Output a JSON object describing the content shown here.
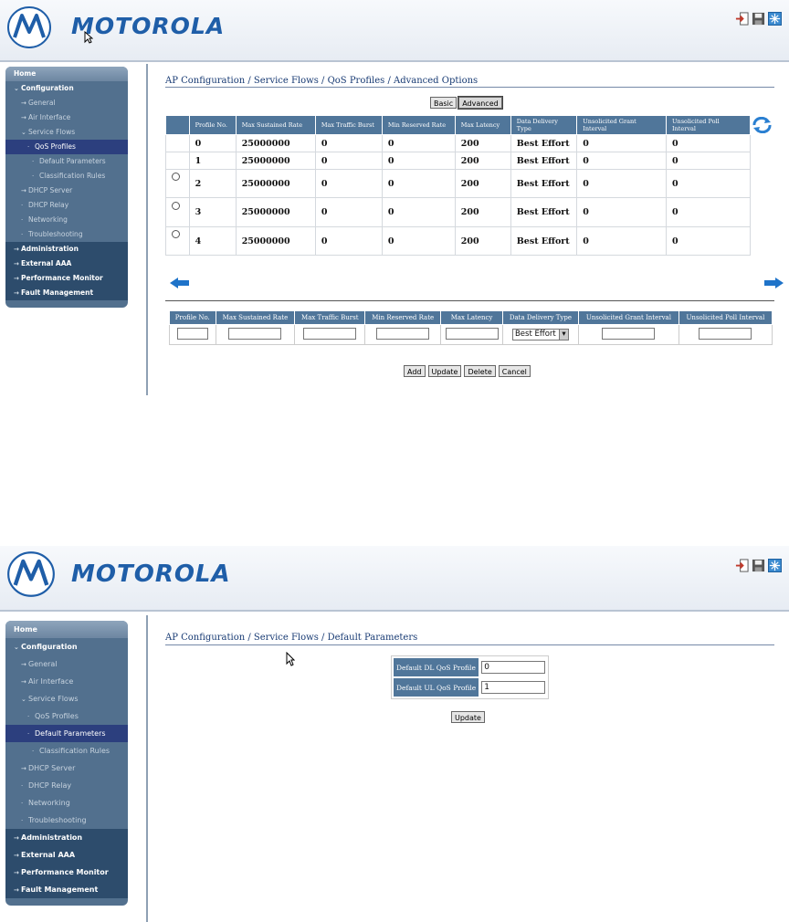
{
  "brand": {
    "name": "MOTOROLA",
    "accent": "#1f5ea8"
  },
  "header_icons": [
    "logout-icon",
    "save-icon",
    "snowflake-icon"
  ],
  "sidebar1": [
    {
      "label": "Home",
      "kind": "home"
    },
    {
      "label": "Configuration",
      "kind": "bold",
      "icon": "chevron-down-icon"
    },
    {
      "label": "General",
      "kind": "l1",
      "icon": "arrow-right-icon"
    },
    {
      "label": "Air Interface",
      "kind": "l1",
      "icon": "arrow-right-icon"
    },
    {
      "label": "Service Flows",
      "kind": "l1",
      "icon": "chevron-down-icon"
    },
    {
      "label": "QoS Profiles",
      "kind": "l2",
      "active": true
    },
    {
      "label": "Default Parameters",
      "kind": "l3"
    },
    {
      "label": "Classification Rules",
      "kind": "l3"
    },
    {
      "label": "DHCP Server",
      "kind": "l1",
      "icon": "arrow-right-icon"
    },
    {
      "label": "DHCP Relay",
      "kind": "l1"
    },
    {
      "label": "Networking",
      "kind": "l1"
    },
    {
      "label": "Troubleshooting",
      "kind": "l1"
    },
    {
      "label": "Administration",
      "kind": "bold-sec",
      "icon": "arrow-right-icon"
    },
    {
      "label": "External AAA",
      "kind": "bold-sec",
      "icon": "arrow-right-icon"
    },
    {
      "label": "Performance Monitor",
      "kind": "bold-sec",
      "icon": "arrow-right-icon"
    },
    {
      "label": "Fault Management",
      "kind": "bold-sec",
      "icon": "arrow-right-icon"
    }
  ],
  "sidebar2": [
    {
      "label": "Home",
      "kind": "home"
    },
    {
      "label": "Configuration",
      "kind": "bold",
      "icon": "chevron-down-icon"
    },
    {
      "label": "General",
      "kind": "l1",
      "icon": "arrow-right-icon"
    },
    {
      "label": "Air Interface",
      "kind": "l1",
      "icon": "arrow-right-icon"
    },
    {
      "label": "Service Flows",
      "kind": "l1",
      "icon": "chevron-down-icon"
    },
    {
      "label": "QoS Profiles",
      "kind": "l2"
    },
    {
      "label": "Default Parameters",
      "kind": "l2",
      "active": true
    },
    {
      "label": "Classification Rules",
      "kind": "l3"
    },
    {
      "label": "DHCP Server",
      "kind": "l1",
      "icon": "arrow-right-icon"
    },
    {
      "label": "DHCP Relay",
      "kind": "l1"
    },
    {
      "label": "Networking",
      "kind": "l1"
    },
    {
      "label": "Troubleshooting",
      "kind": "l1"
    },
    {
      "label": "Administration",
      "kind": "bold-sec",
      "icon": "arrow-right-icon"
    },
    {
      "label": "External AAA",
      "kind": "bold-sec",
      "icon": "arrow-right-icon"
    },
    {
      "label": "Performance Monitor",
      "kind": "bold-sec",
      "icon": "arrow-right-icon"
    },
    {
      "label": "Fault Management",
      "kind": "bold-sec",
      "icon": "arrow-right-icon"
    }
  ],
  "qos": {
    "breadcrumb": "AP Configuration / Service Flows / QoS Profiles / Advanced Options",
    "tabs": [
      "Basic",
      "Advanced"
    ],
    "columns": [
      "Profile No.",
      "Max Sustained Rate",
      "Max Traffic Burst",
      "Min Reserved Rate",
      "Max Latency",
      "Data Delivery Type",
      "Unsolicited Grant Interval",
      "Unsolicited Poll Interval"
    ],
    "rows": [
      {
        "radio": false,
        "cells": [
          "0",
          "25000000",
          "0",
          "0",
          "200",
          "Best Effort",
          "0",
          "0"
        ]
      },
      {
        "radio": false,
        "cells": [
          "1",
          "25000000",
          "0",
          "0",
          "200",
          "Best Effort",
          "0",
          "0"
        ]
      },
      {
        "radio": true,
        "cells": [
          "2",
          "25000000",
          "0",
          "0",
          "200",
          "Best Effort",
          "0",
          "0"
        ]
      },
      {
        "radio": true,
        "cells": [
          "3",
          "25000000",
          "0",
          "0",
          "200",
          "Best Effort",
          "0",
          "0"
        ]
      },
      {
        "radio": true,
        "cells": [
          "4",
          "25000000",
          "0",
          "0",
          "200",
          "Best Effort",
          "0",
          "0"
        ]
      }
    ],
    "form_columns": [
      "Profile No.",
      "Max Sustained Rate",
      "Max Traffic Burst",
      "Min Reserved Rate",
      "Max Latency",
      "Data Delivery Type",
      "Unsolicited Grant Interval",
      "Unsolicited Poll Interval"
    ],
    "delivery_type_selected": "Best Effort",
    "buttons": [
      "Add",
      "Update",
      "Delete",
      "Cancel"
    ]
  },
  "defaults": {
    "breadcrumb": "AP Configuration / Service Flows / Default Parameters",
    "dl_label": "Default DL QoS Profile",
    "dl_value": "0",
    "ul_label": "Default UL QoS Profile",
    "ul_value": "1",
    "update_label": "Update"
  }
}
